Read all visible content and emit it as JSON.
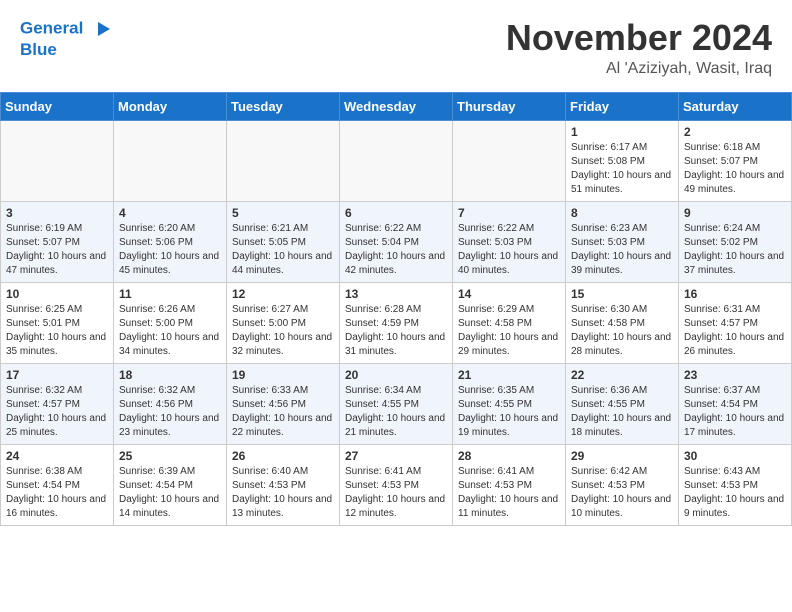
{
  "header": {
    "logo_line1": "General",
    "logo_line2": "Blue",
    "month": "November 2024",
    "location": "Al 'Aziziyah, Wasit, Iraq"
  },
  "weekdays": [
    "Sunday",
    "Monday",
    "Tuesday",
    "Wednesday",
    "Thursday",
    "Friday",
    "Saturday"
  ],
  "weeks": [
    [
      {
        "day": "",
        "info": ""
      },
      {
        "day": "",
        "info": ""
      },
      {
        "day": "",
        "info": ""
      },
      {
        "day": "",
        "info": ""
      },
      {
        "day": "",
        "info": ""
      },
      {
        "day": "1",
        "info": "Sunrise: 6:17 AM\nSunset: 5:08 PM\nDaylight: 10 hours and 51 minutes."
      },
      {
        "day": "2",
        "info": "Sunrise: 6:18 AM\nSunset: 5:07 PM\nDaylight: 10 hours and 49 minutes."
      }
    ],
    [
      {
        "day": "3",
        "info": "Sunrise: 6:19 AM\nSunset: 5:07 PM\nDaylight: 10 hours and 47 minutes."
      },
      {
        "day": "4",
        "info": "Sunrise: 6:20 AM\nSunset: 5:06 PM\nDaylight: 10 hours and 45 minutes."
      },
      {
        "day": "5",
        "info": "Sunrise: 6:21 AM\nSunset: 5:05 PM\nDaylight: 10 hours and 44 minutes."
      },
      {
        "day": "6",
        "info": "Sunrise: 6:22 AM\nSunset: 5:04 PM\nDaylight: 10 hours and 42 minutes."
      },
      {
        "day": "7",
        "info": "Sunrise: 6:22 AM\nSunset: 5:03 PM\nDaylight: 10 hours and 40 minutes."
      },
      {
        "day": "8",
        "info": "Sunrise: 6:23 AM\nSunset: 5:03 PM\nDaylight: 10 hours and 39 minutes."
      },
      {
        "day": "9",
        "info": "Sunrise: 6:24 AM\nSunset: 5:02 PM\nDaylight: 10 hours and 37 minutes."
      }
    ],
    [
      {
        "day": "10",
        "info": "Sunrise: 6:25 AM\nSunset: 5:01 PM\nDaylight: 10 hours and 35 minutes."
      },
      {
        "day": "11",
        "info": "Sunrise: 6:26 AM\nSunset: 5:00 PM\nDaylight: 10 hours and 34 minutes."
      },
      {
        "day": "12",
        "info": "Sunrise: 6:27 AM\nSunset: 5:00 PM\nDaylight: 10 hours and 32 minutes."
      },
      {
        "day": "13",
        "info": "Sunrise: 6:28 AM\nSunset: 4:59 PM\nDaylight: 10 hours and 31 minutes."
      },
      {
        "day": "14",
        "info": "Sunrise: 6:29 AM\nSunset: 4:58 PM\nDaylight: 10 hours and 29 minutes."
      },
      {
        "day": "15",
        "info": "Sunrise: 6:30 AM\nSunset: 4:58 PM\nDaylight: 10 hours and 28 minutes."
      },
      {
        "day": "16",
        "info": "Sunrise: 6:31 AM\nSunset: 4:57 PM\nDaylight: 10 hours and 26 minutes."
      }
    ],
    [
      {
        "day": "17",
        "info": "Sunrise: 6:32 AM\nSunset: 4:57 PM\nDaylight: 10 hours and 25 minutes."
      },
      {
        "day": "18",
        "info": "Sunrise: 6:32 AM\nSunset: 4:56 PM\nDaylight: 10 hours and 23 minutes."
      },
      {
        "day": "19",
        "info": "Sunrise: 6:33 AM\nSunset: 4:56 PM\nDaylight: 10 hours and 22 minutes."
      },
      {
        "day": "20",
        "info": "Sunrise: 6:34 AM\nSunset: 4:55 PM\nDaylight: 10 hours and 21 minutes."
      },
      {
        "day": "21",
        "info": "Sunrise: 6:35 AM\nSunset: 4:55 PM\nDaylight: 10 hours and 19 minutes."
      },
      {
        "day": "22",
        "info": "Sunrise: 6:36 AM\nSunset: 4:55 PM\nDaylight: 10 hours and 18 minutes."
      },
      {
        "day": "23",
        "info": "Sunrise: 6:37 AM\nSunset: 4:54 PM\nDaylight: 10 hours and 17 minutes."
      }
    ],
    [
      {
        "day": "24",
        "info": "Sunrise: 6:38 AM\nSunset: 4:54 PM\nDaylight: 10 hours and 16 minutes."
      },
      {
        "day": "25",
        "info": "Sunrise: 6:39 AM\nSunset: 4:54 PM\nDaylight: 10 hours and 14 minutes."
      },
      {
        "day": "26",
        "info": "Sunrise: 6:40 AM\nSunset: 4:53 PM\nDaylight: 10 hours and 13 minutes."
      },
      {
        "day": "27",
        "info": "Sunrise: 6:41 AM\nSunset: 4:53 PM\nDaylight: 10 hours and 12 minutes."
      },
      {
        "day": "28",
        "info": "Sunrise: 6:41 AM\nSunset: 4:53 PM\nDaylight: 10 hours and 11 minutes."
      },
      {
        "day": "29",
        "info": "Sunrise: 6:42 AM\nSunset: 4:53 PM\nDaylight: 10 hours and 10 minutes."
      },
      {
        "day": "30",
        "info": "Sunrise: 6:43 AM\nSunset: 4:53 PM\nDaylight: 10 hours and 9 minutes."
      }
    ]
  ]
}
